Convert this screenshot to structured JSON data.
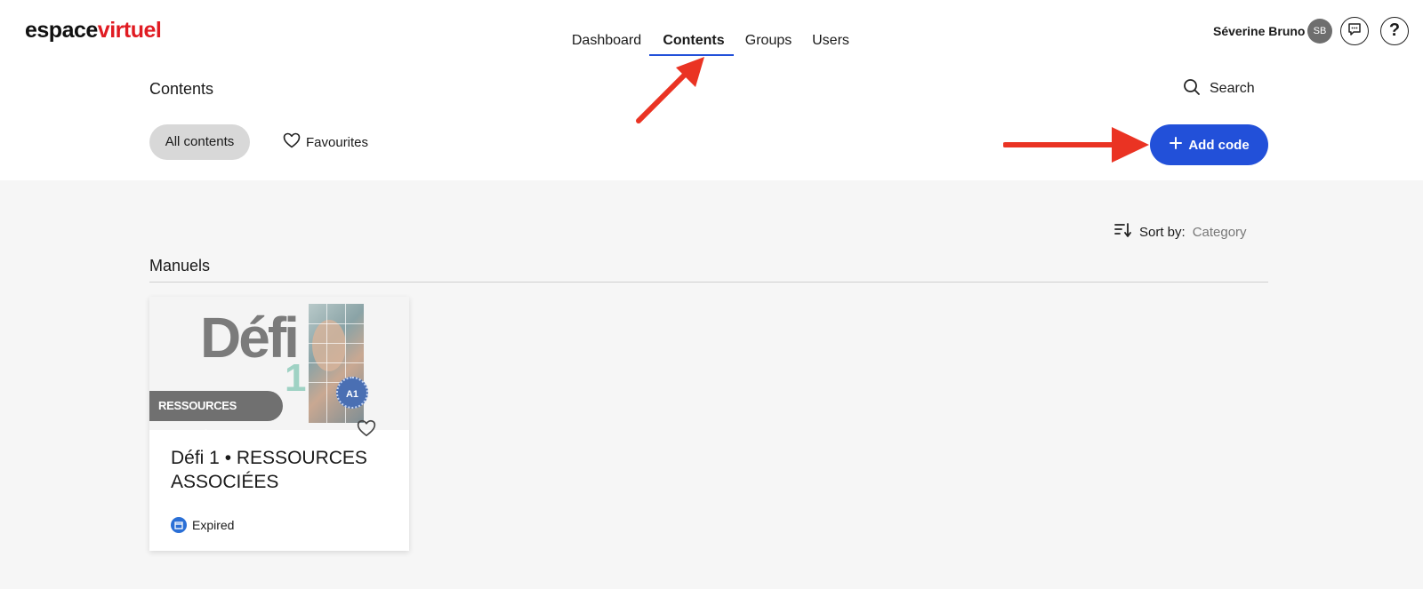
{
  "header": {
    "logo_part1": "espace",
    "logo_part2": "virtuel",
    "nav": [
      {
        "label": "Dashboard"
      },
      {
        "label": "Contents",
        "active": true
      },
      {
        "label": "Groups"
      },
      {
        "label": "Users"
      }
    ],
    "user": {
      "name": "Séverine Bruno",
      "initials": "SB"
    },
    "help_label": "?"
  },
  "page": {
    "title": "Contents",
    "search_label": "Search",
    "tabs": [
      {
        "label": "All contents",
        "active": true
      },
      {
        "label": "Favourites"
      }
    ],
    "add_code_label": "Add code",
    "sort": {
      "label": "Sort by:",
      "value": "Category"
    }
  },
  "section": {
    "title": "Manuels",
    "cards": [
      {
        "cover": {
          "title": "Défi",
          "number": "1",
          "ribbon": "RESSOURCES ASSOCIÉES",
          "level": "A1"
        },
        "title": "Défi 1 • RESSOURCES ASSOCIÉES",
        "status": "Expired"
      }
    ]
  },
  "colors": {
    "accent": "#2250d9",
    "logo_red": "#e01b22",
    "annotation_arrow": "#ea3323"
  },
  "icons": [
    "chat-icon",
    "help-icon",
    "search-icon",
    "heart-icon",
    "plus-icon",
    "sort-icon",
    "calendar-icon",
    "arrow-annotation"
  ]
}
